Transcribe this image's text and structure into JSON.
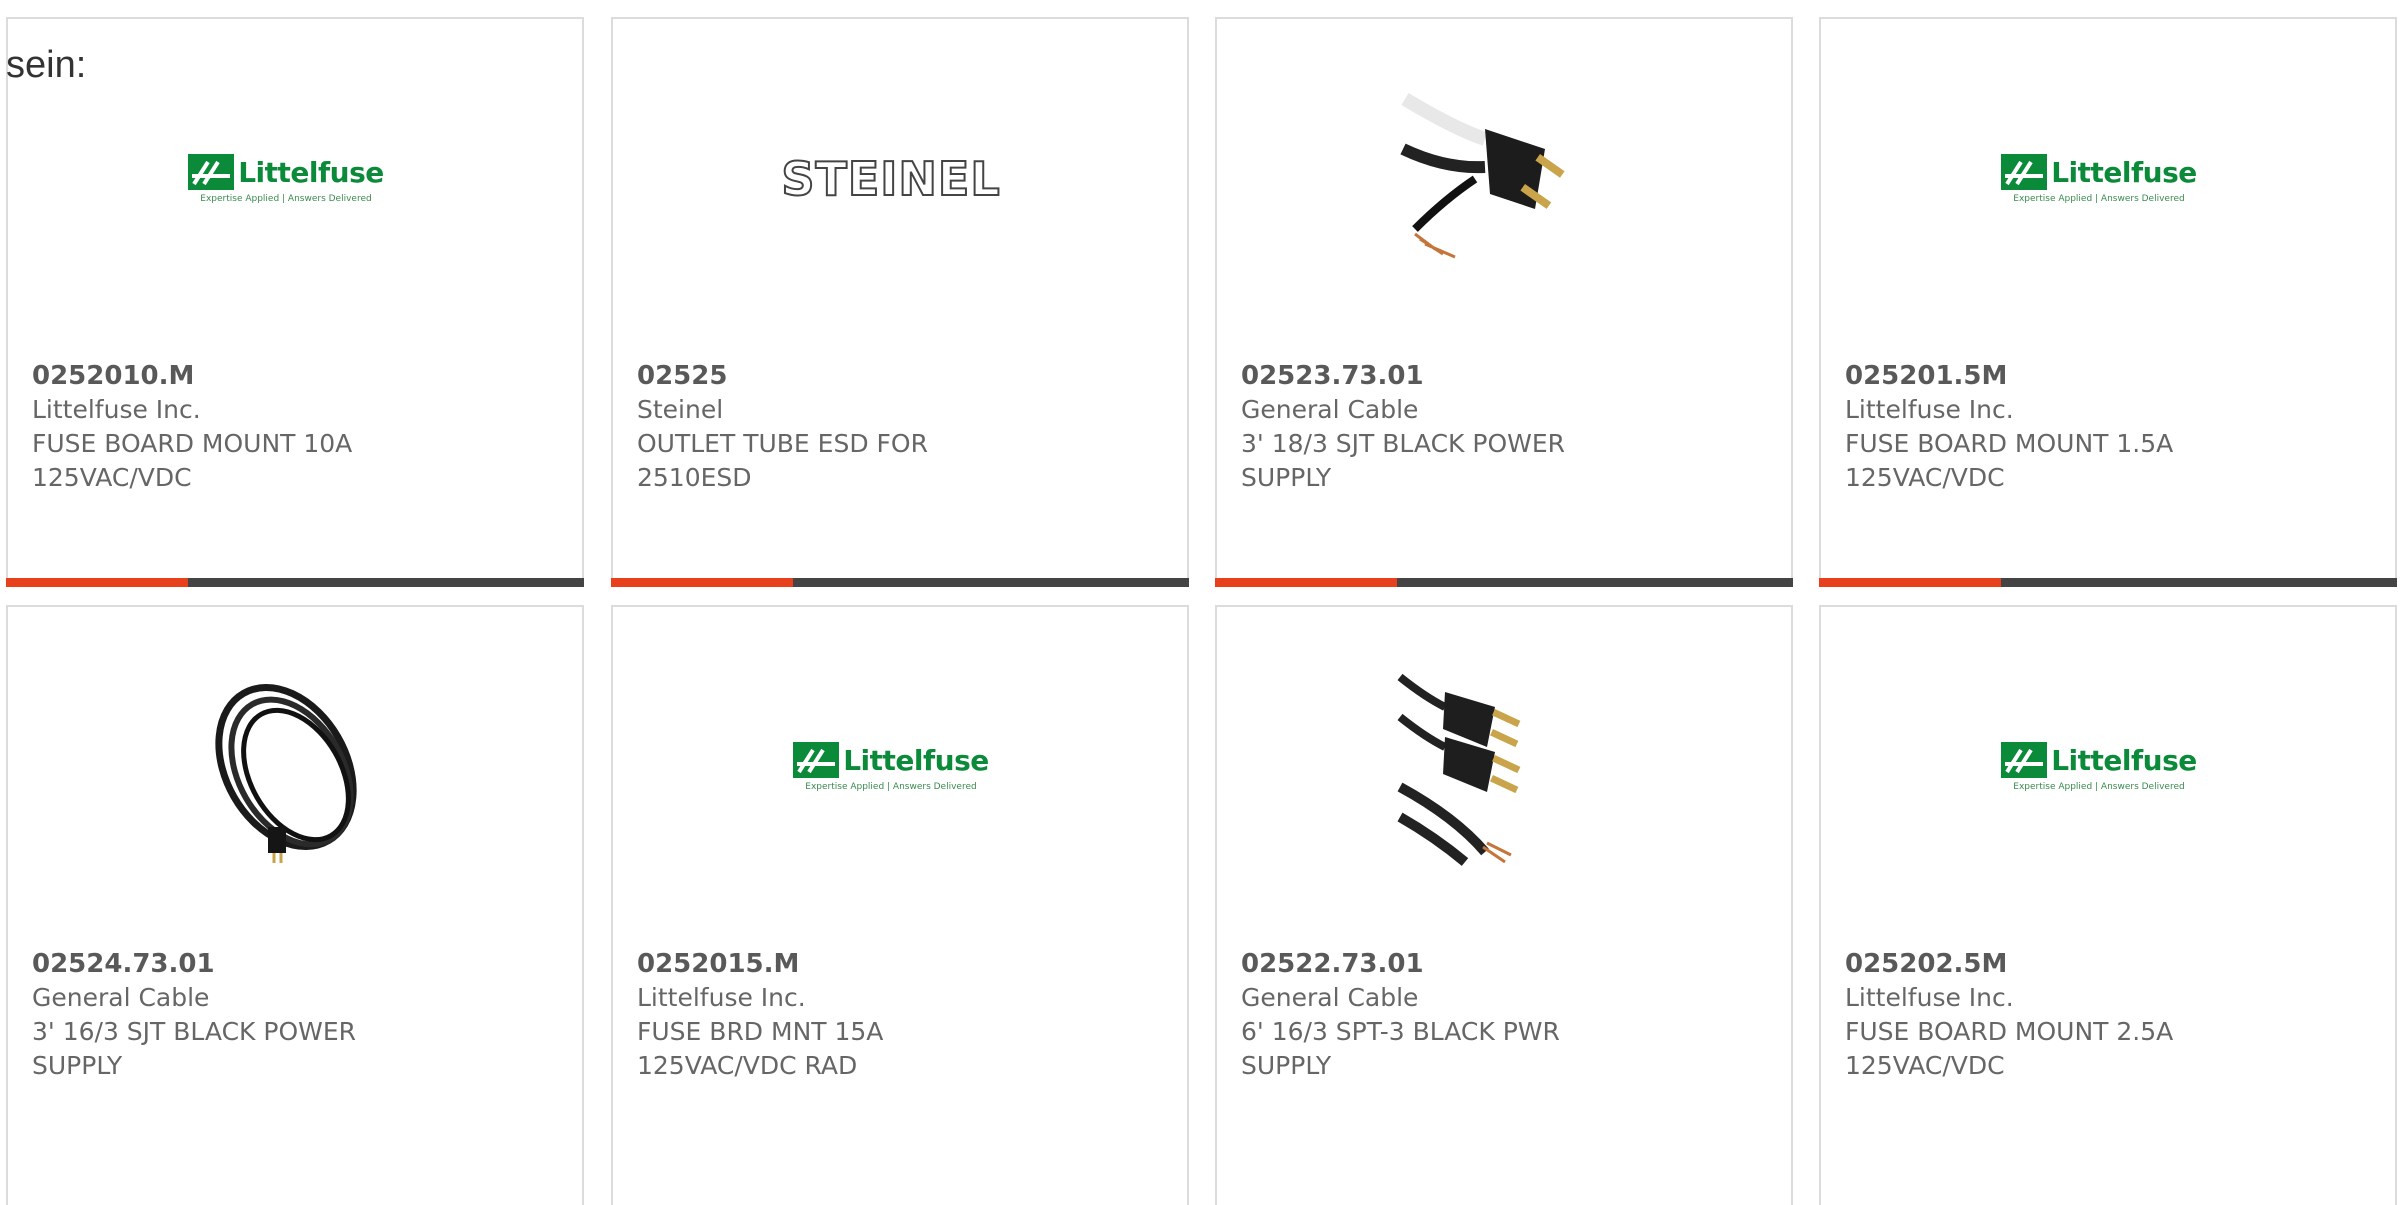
{
  "intro_text": "sein:",
  "colors": {
    "accent_bar": "#e8401c",
    "bar_rest": "#444444",
    "littelfuse_green": "#0b8a3a"
  },
  "products": [
    {
      "part_number": "0252010.M",
      "manufacturer": "Littelfuse Inc.",
      "description": "FUSE BOARD MOUNT 10A 125VAC/VDC",
      "image": "littelfuse-logo",
      "logo_text": "Littelfuse",
      "logo_tagline": "Expertise Applied | Answers Delivered"
    },
    {
      "part_number": "02525",
      "manufacturer": "Steinel",
      "description": "OUTLET TUBE ESD FOR 2510ESD",
      "image": "steinel-logo",
      "logo_text": "STEINEL"
    },
    {
      "part_number": "02523.73.01",
      "manufacturer": "General Cable",
      "description": "3' 18/3 SJT BLACK POWER SUPPLY",
      "image": "power-cord-plug-photo"
    },
    {
      "part_number": "025201.5M",
      "manufacturer": "Littelfuse Inc.",
      "description": "FUSE BOARD MOUNT 1.5A 125VAC/VDC",
      "image": "littelfuse-logo",
      "logo_text": "Littelfuse",
      "logo_tagline": "Expertise Applied | Answers Delivered"
    },
    {
      "part_number": "02524.73.01",
      "manufacturer": "General Cable",
      "description": "3' 16/3 SJT BLACK POWER SUPPLY",
      "image": "coiled-power-cord-photo"
    },
    {
      "part_number": "0252015.M",
      "manufacturer": "Littelfuse Inc.",
      "description": "FUSE BRD MNT 15A 125VAC/VDC RAD",
      "image": "littelfuse-logo",
      "logo_text": "Littelfuse",
      "logo_tagline": "Expertise Applied | Answers Delivered"
    },
    {
      "part_number": "02522.73.01",
      "manufacturer": "General Cable",
      "description": "6' 16/3 SPT-3 BLACK PWR SUPPLY",
      "image": "two-power-cords-photo"
    },
    {
      "part_number": "025202.5M",
      "manufacturer": "Littelfuse Inc.",
      "description": "FUSE BOARD MOUNT 2.5A 125VAC/VDC",
      "image": "littelfuse-logo",
      "logo_text": "Littelfuse",
      "logo_tagline": "Expertise Applied | Answers Delivered"
    }
  ]
}
